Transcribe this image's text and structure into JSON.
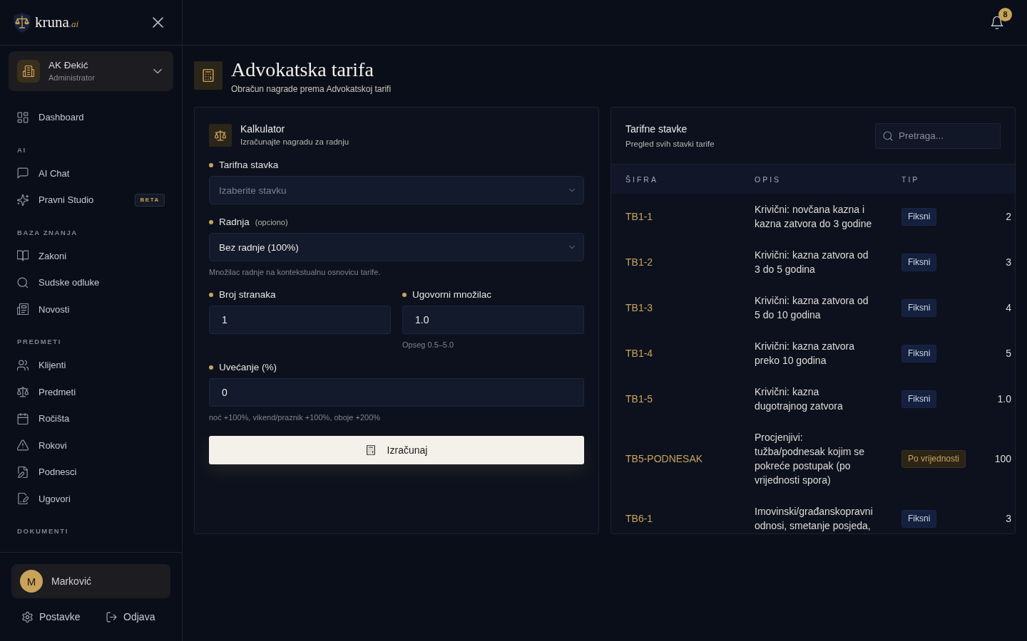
{
  "sidebar": {
    "logo": {
      "name": "kruna",
      "suffix": ".ai"
    },
    "organization": {
      "name": "AK Đekić",
      "role": "Administrator"
    },
    "sections": [
      {
        "items": [
          {
            "label": "Dashboard",
            "selected": false
          }
        ]
      },
      {
        "title": "AI",
        "items": [
          {
            "label": "AI Chat",
            "selected": false
          },
          {
            "label": "Pravni Studio",
            "badge": "BETA",
            "selected": false
          }
        ]
      },
      {
        "title": "BAZA ZNANJA",
        "items": [
          {
            "label": "Zakoni",
            "selected": false
          },
          {
            "label": "Sudske odluke",
            "selected": false
          },
          {
            "label": "Novosti",
            "selected": false
          }
        ]
      },
      {
        "title": "PREDMETI",
        "items": [
          {
            "label": "Klijenti",
            "selected": false
          },
          {
            "label": "Predmeti",
            "selected": false
          },
          {
            "label": "Ročišta",
            "selected": false
          },
          {
            "label": "Rokovi",
            "selected": false
          },
          {
            "label": "Podnesci",
            "selected": false
          },
          {
            "label": "Ugovori",
            "selected": false
          }
        ]
      },
      {
        "title": "DOKUMENTI"
      }
    ],
    "user": {
      "initial": "M",
      "name": "Marković"
    },
    "footer_links": [
      "Postavke",
      "Odjava"
    ]
  },
  "header": {
    "notifications": "8"
  },
  "page": {
    "title": "Advokatska tarifa",
    "subtitle": "Obračun nagrade prema Advokatskoj tarifi"
  },
  "calculator": {
    "title": "Kalkulator",
    "subtitle": "Izračunajte nagradu za radnju",
    "rows": [
      [
        {
          "kind": "select",
          "label": "Tarifna stavka",
          "placeholder": "Izaberite stavku"
        }
      ],
      [
        {
          "kind": "select",
          "label": "Radnja",
          "note": "(opciono)",
          "value": "Bez radnje (100%)",
          "hint": "Množilac radnje na kontekstualnu osnovicu tarife."
        }
      ],
      [
        {
          "kind": "input",
          "label": "Broj stranaka",
          "value": "1"
        },
        {
          "kind": "input",
          "label": "Ugovorni množilac",
          "value": "1.0",
          "hint": "Opseg 0.5–5.0"
        }
      ],
      [
        {
          "kind": "input",
          "label": "Uvećanje (%)",
          "value": "0",
          "hint": "noć +100%, vikend/praznik +100%, oboje +200%"
        }
      ]
    ],
    "button": "Izračunaj"
  },
  "tariff_table": {
    "title": "Tarifne stavke",
    "subtitle": "Pregled svih stavki tarife",
    "search": {
      "placeholder": "Pretraga..."
    },
    "columns": [
      "ŠIFRA",
      "OPIS",
      "TIP"
    ],
    "rows": [
      {
        "code": "TB1-1",
        "description": "Krivični: novčana kazna i kazna zatvora do 3 godine",
        "type": {
          "label": "Fiksni",
          "kind": "fixed"
        },
        "column_4": "2"
      },
      {
        "code": "TB1-2",
        "description": "Krivični: kazna zatvora od 3 do 5 godina",
        "type": {
          "label": "Fiksni",
          "kind": "fixed"
        },
        "column_4": "3"
      },
      {
        "code": "TB1-3",
        "description": "Krivični: kazna zatvora od 5 do 10 godina",
        "type": {
          "label": "Fiksni",
          "kind": "fixed"
        },
        "column_4": "4"
      },
      {
        "code": "TB1-4",
        "description": "Krivični: kazna zatvora preko 10 godina",
        "type": {
          "label": "Fiksni",
          "kind": "fixed"
        },
        "column_4": "5"
      },
      {
        "code": "TB1-5",
        "description": "Krivični: kazna dugotrajnog zatvora",
        "type": {
          "label": "Fiksni",
          "kind": "fixed"
        },
        "column_4": "1.0"
      },
      {
        "code": "TB5-PODNESAK",
        "description": "Procjenjivi: tužba/podnesak kojim se pokreće postupak (po vrijednosti spora)",
        "type": {
          "label": "Po vrijednosti",
          "kind": "value"
        },
        "column_4": "100"
      },
      {
        "code": "TB6-1",
        "description": "Imovinski/građanskopravni odnosi, smetanje posjeda,",
        "type": {
          "label": "Fiksni",
          "kind": "fixed"
        },
        "column_4": "3"
      }
    ]
  }
}
